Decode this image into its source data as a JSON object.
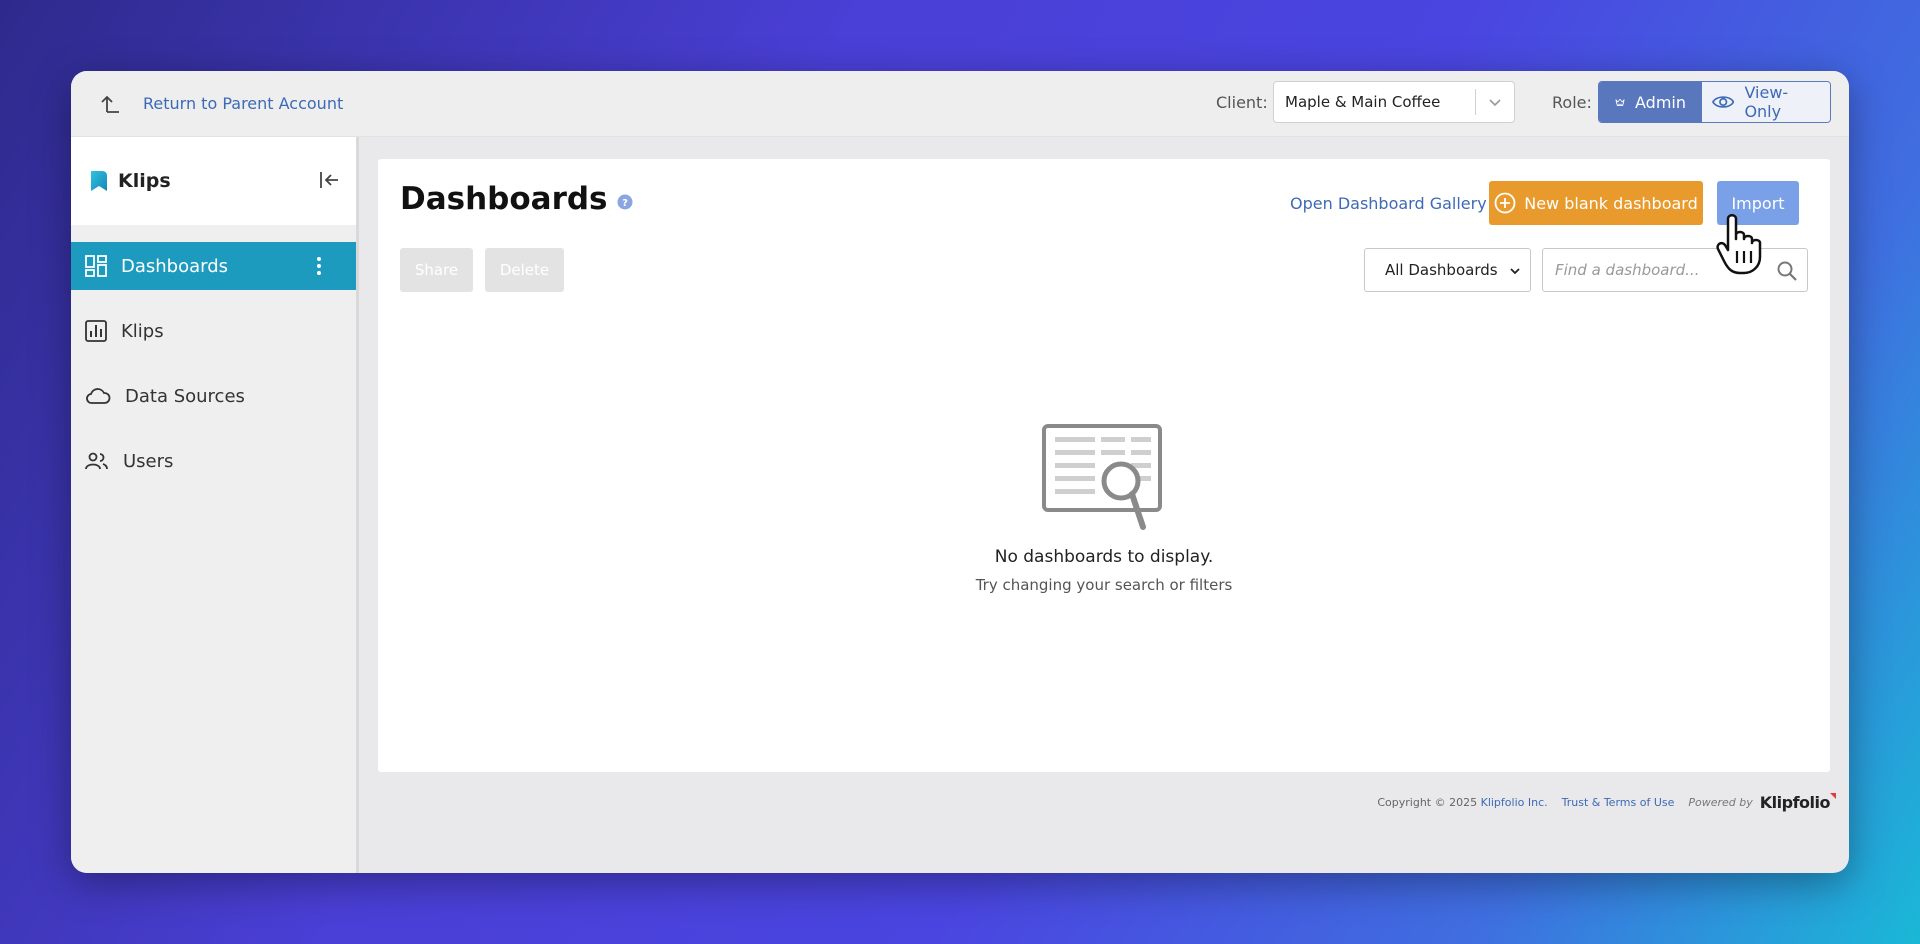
{
  "topbar": {
    "return_label": "Return to Parent Account",
    "client_label": "Client:",
    "client_value": "Maple & Main Coffee",
    "role_label": "Role:",
    "role_admin": "Admin",
    "role_view_only": "View-Only",
    "role_selected": "Admin"
  },
  "sidebar": {
    "brand": "Klips",
    "items": [
      {
        "label": "Dashboards",
        "icon": "dashboards-icon",
        "active": true
      },
      {
        "label": "Klips",
        "icon": "chart-icon"
      },
      {
        "label": "Data Sources",
        "icon": "cloud-icon"
      },
      {
        "label": "Users",
        "icon": "users-icon"
      }
    ]
  },
  "main": {
    "title": "Dashboards",
    "gallery_link": "Open Dashboard Gallery",
    "new_button": "New blank dashboard",
    "import_button": "Import",
    "share_button": "Share",
    "delete_button": "Delete",
    "filter_value": "All Dashboards",
    "search_placeholder": "Find a dashboard...",
    "empty_title": "No dashboards to display.",
    "empty_subtitle": "Try changing your search or filters"
  },
  "footer": {
    "copyright": "Copyright © 2025",
    "company_link": "Klipfolio Inc.",
    "terms_link": "Trust & Terms of Use",
    "powered_by": "Powered by",
    "logo_text": "Klipfolio"
  },
  "colors": {
    "active_nav": "#1c9bbf",
    "new_button": "#e99a2c",
    "import_button": "#7aa0e8",
    "role_admin": "#5877bd",
    "link": "#3d6ab5"
  }
}
